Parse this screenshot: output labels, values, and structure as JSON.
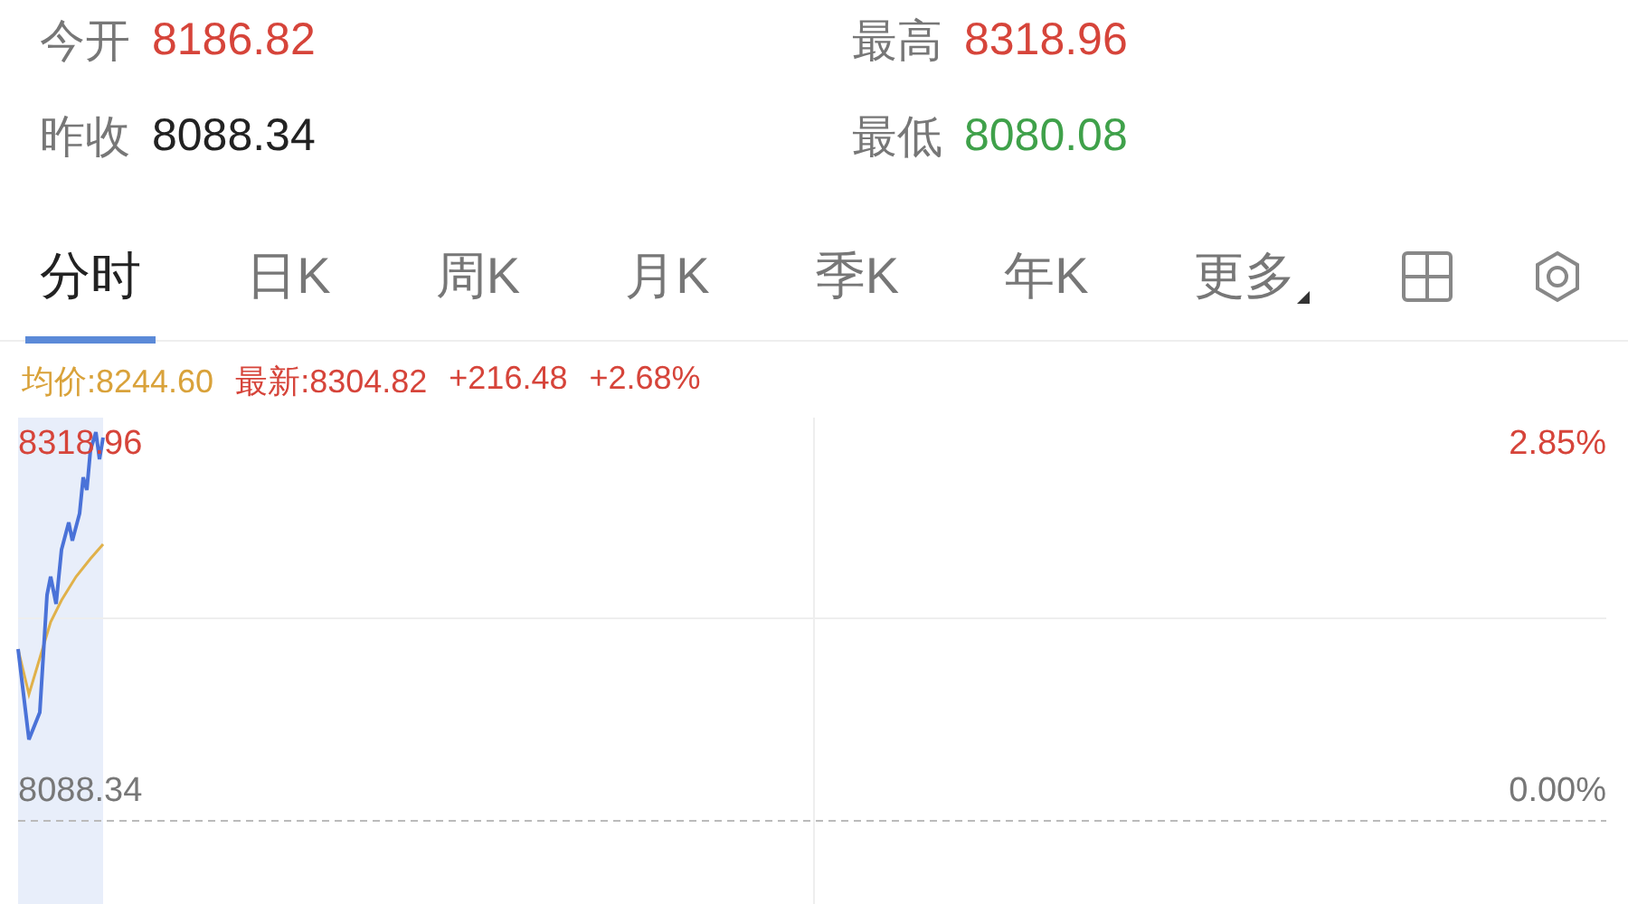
{
  "quote": [
    {
      "label": "今开",
      "value": "8186.82",
      "color": "#d6443a"
    },
    {
      "label": "最高",
      "value": "8318.96",
      "color": "#d6443a"
    },
    {
      "label": "昨收",
      "value": "8088.34",
      "color": "#222222"
    },
    {
      "label": "最低",
      "value": "8080.08",
      "color": "#3fa14a"
    }
  ],
  "tabs": [
    {
      "label": "分时",
      "selected": true
    },
    {
      "label": "日K",
      "selected": false
    },
    {
      "label": "周K",
      "selected": false
    },
    {
      "label": "月K",
      "selected": false
    },
    {
      "label": "季K",
      "selected": false
    },
    {
      "label": "年K",
      "selected": false
    },
    {
      "label": "更多",
      "selected": false
    }
  ],
  "info": {
    "average": "均价:8244.60",
    "latest": "最新:8304.82",
    "change": "+216.48",
    "change_pct": "+2.68%"
  },
  "chart": {
    "high_price": "8318.96",
    "high_pct": "2.85%",
    "base_price": "8088.34",
    "base_pct": "0.00%"
  }
}
